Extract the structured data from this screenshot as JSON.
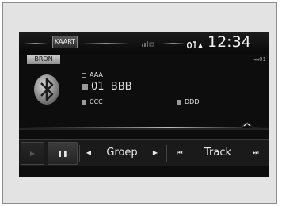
{
  "status": {
    "map_button": "KAART",
    "signal_icon": "signal-icon",
    "status_icon": "bluetooth-status-icon",
    "clock": "12:34"
  },
  "source": {
    "button": "BRON",
    "preset": "01"
  },
  "track_info": {
    "artist": "AAA",
    "title": "01  BBB",
    "album": "CCC",
    "genre": "DDD"
  },
  "controls": {
    "group_label": "Groep",
    "track_label": "Track",
    "icons": [
      "play-icon",
      "pause-icon",
      "prev-group-icon",
      "next-group-icon",
      "prev-track-icon",
      "next-track-icon"
    ]
  },
  "colors": {
    "screen_bg": "#0d0d0d",
    "text": "#e0e0e0",
    "bezel": "#e3e3e3"
  }
}
